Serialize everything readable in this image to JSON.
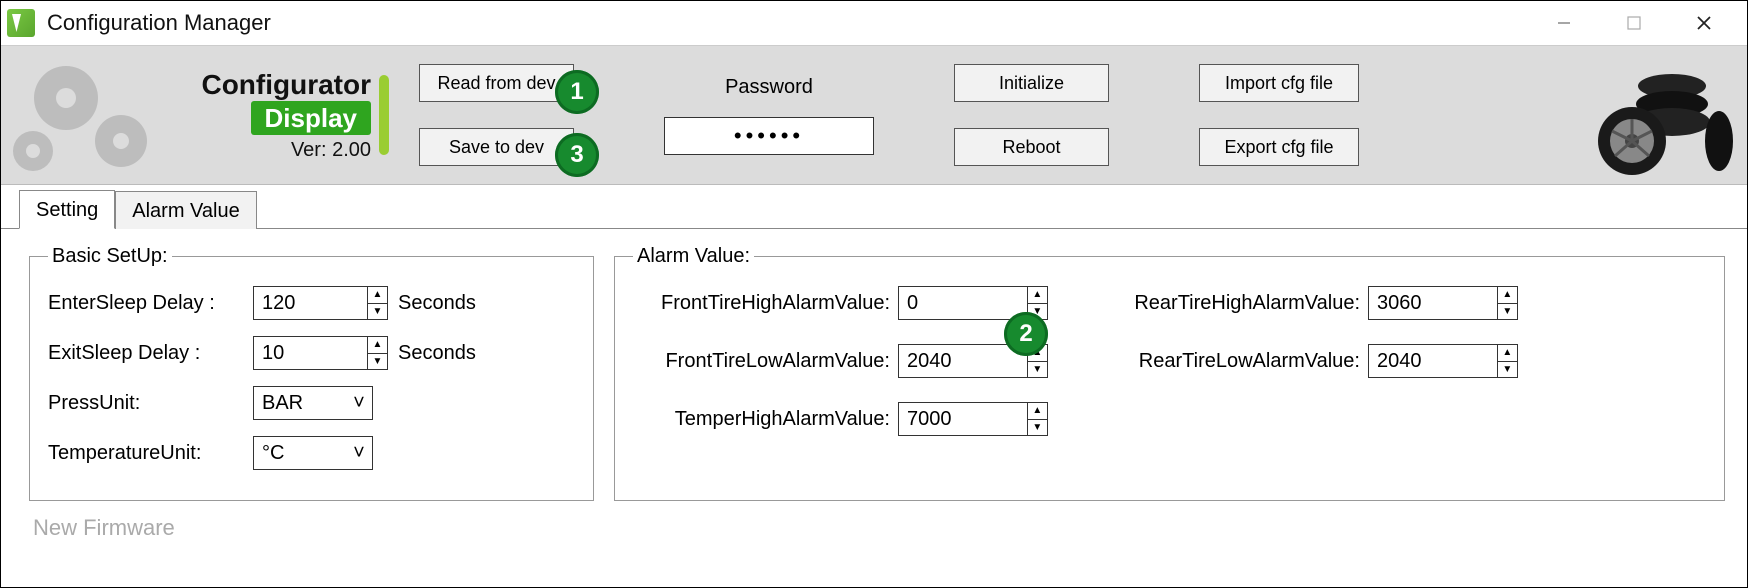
{
  "window": {
    "title": "Configuration Manager"
  },
  "brand": {
    "title": "Configurator",
    "subtitle": "Display",
    "version": "Ver: 2.00"
  },
  "toolbar": {
    "read_from_dev": "Read from dev",
    "save_to_dev": "Save to dev",
    "password_label": "Password",
    "password_value": "••••••",
    "initialize": "Initialize",
    "reboot": "Reboot",
    "import_cfg": "Import cfg file",
    "export_cfg": "Export cfg file"
  },
  "tabs": {
    "setting": "Setting",
    "alarm_value": "Alarm Value"
  },
  "basic": {
    "legend": "Basic SetUp:",
    "enter_sleep_label": "EnterSleep Delay :",
    "enter_sleep_value": "120",
    "exit_sleep_label": "ExitSleep Delay :",
    "exit_sleep_value": "10",
    "seconds": "Seconds",
    "press_unit_label": "PressUnit:",
    "press_unit_value": "BAR",
    "temp_unit_label": "TemperatureUnit:",
    "temp_unit_value": "°C"
  },
  "alarm": {
    "legend": "Alarm Value:",
    "front_high_label": "FrontTireHighAlarmValue:",
    "front_high_value": "0",
    "front_low_label": "FrontTireLowAlarmValue:",
    "front_low_value": "2040",
    "temper_high_label": "TemperHighAlarmValue:",
    "temper_high_value": "7000",
    "rear_high_label": "RearTireHighAlarmValue:",
    "rear_high_value": "3060",
    "rear_low_label": "RearTireLowAlarmValue:",
    "rear_low_value": "2040"
  },
  "new_firmware": "New Firmware",
  "callouts": {
    "c1": "1",
    "c2": "2",
    "c3": "3"
  }
}
